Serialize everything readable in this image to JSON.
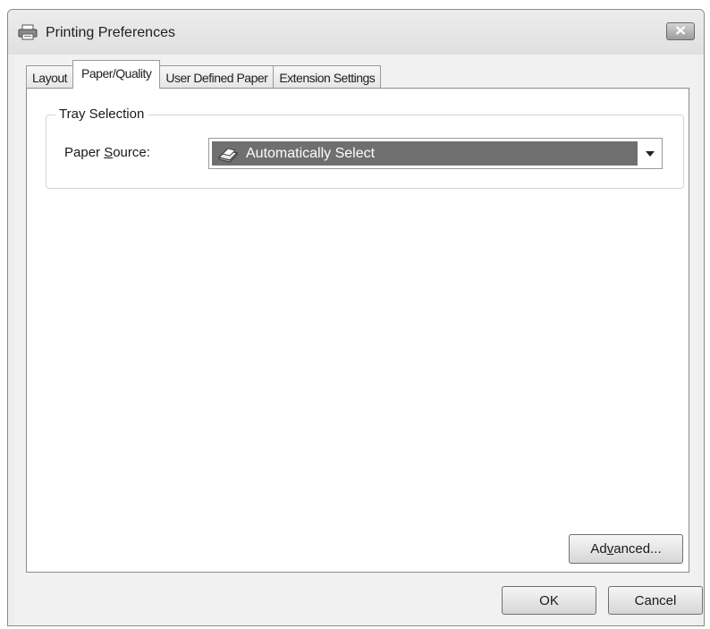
{
  "window": {
    "title": "Printing Preferences"
  },
  "tabs": [
    {
      "label": "Layout"
    },
    {
      "label": "Paper/Quality"
    },
    {
      "label": "User Defined Paper"
    },
    {
      "label": "Extension Settings"
    }
  ],
  "active_tab": "Paper/Quality",
  "tray_selection": {
    "group_label": "Tray Selection",
    "paper_source_label_pre": "Paper ",
    "paper_source_label_key": "S",
    "paper_source_label_post": "ource:",
    "paper_source_value": "Automatically Select"
  },
  "buttons": {
    "advanced_pre": "Ad",
    "advanced_key": "v",
    "advanced_post": "anced...",
    "ok": "OK",
    "cancel": "Cancel"
  },
  "icons": {
    "title": "printer-icon",
    "close": "close-icon",
    "paper_source": "paper-tray-icon",
    "dropdown": "chevron-down-icon"
  },
  "colors": {
    "selection_bg": "#6f6f6f",
    "panel_bg": "#ffffff",
    "window_bg": "#eeeeee"
  }
}
